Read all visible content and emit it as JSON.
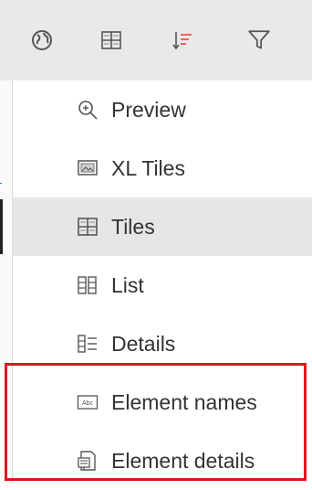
{
  "toolbar": {
    "buttons": [
      {
        "icon": "globe-icon"
      },
      {
        "icon": "grid-view-icon"
      },
      {
        "icon": "sort-icon",
        "accent": "#e85a4f"
      },
      {
        "icon": "filter-icon"
      }
    ]
  },
  "view_menu": {
    "items": [
      {
        "label": "Preview",
        "icon": "zoom-preview-icon",
        "selected": false
      },
      {
        "label": "XL Tiles",
        "icon": "xl-tiles-icon",
        "selected": false
      },
      {
        "label": "Tiles",
        "icon": "tiles-icon",
        "selected": true
      },
      {
        "label": "List",
        "icon": "list-icon",
        "selected": false
      },
      {
        "label": "Details",
        "icon": "details-icon",
        "selected": false
      },
      {
        "label": "Element names",
        "icon": "element-names-icon",
        "selected": false
      },
      {
        "label": "Element details",
        "icon": "element-details-icon",
        "selected": false
      }
    ]
  },
  "colors": {
    "toolbar_bg": "#e9e9e9",
    "selected_bg": "#e6e6e6",
    "highlight_border": "#e3141f",
    "text": "#333333"
  }
}
